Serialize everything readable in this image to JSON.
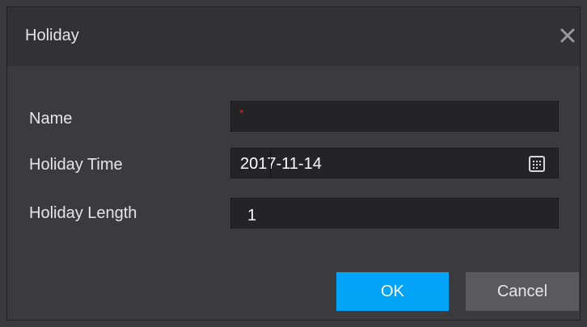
{
  "dialog": {
    "title": "Holiday",
    "close_icon": "close-icon"
  },
  "form": {
    "name": {
      "label": "Name",
      "value": "",
      "required_marker": "*"
    },
    "holiday_time": {
      "label": "Holiday Time",
      "value": "2017-11-14",
      "icon": "calendar-icon"
    },
    "holiday_length": {
      "label": "Holiday Length",
      "value": "1"
    }
  },
  "buttons": {
    "ok_label": "OK",
    "cancel_label": "Cancel"
  },
  "colors": {
    "accent": "#00a3f6",
    "required": "#e0202a"
  }
}
